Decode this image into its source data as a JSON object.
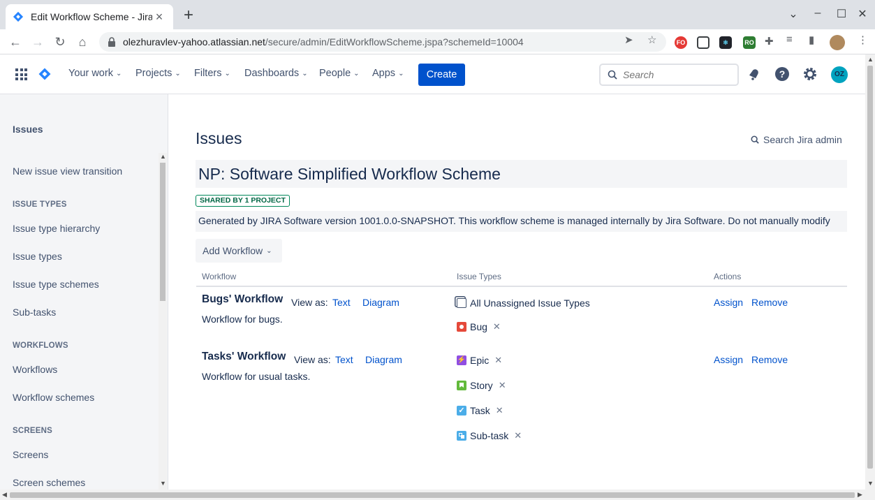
{
  "browser": {
    "tab_title": "Edit Workflow Scheme - Jira",
    "url_host": "olezhuravlev-yahoo.atlassian.net",
    "url_path": "/secure/admin/EditWorkflowScheme.jspa?schemeId=10004",
    "extensions": [
      "FO",
      "",
      "",
      "RO"
    ]
  },
  "topnav": {
    "items": [
      "Your work",
      "Projects",
      "Filters",
      "Dashboards",
      "People",
      "Apps"
    ],
    "create_label": "Create",
    "search_placeholder": "Search",
    "avatar_initials": "OZ"
  },
  "sidebar": {
    "title": "Issues",
    "items": [
      {
        "type": "item",
        "label": "New issue view transition"
      },
      {
        "type": "header",
        "label": "ISSUE TYPES"
      },
      {
        "type": "item",
        "label": "Issue type hierarchy"
      },
      {
        "type": "item",
        "label": "Issue types"
      },
      {
        "type": "item",
        "label": "Issue type schemes"
      },
      {
        "type": "item",
        "label": "Sub-tasks"
      },
      {
        "type": "header",
        "label": "WORKFLOWS"
      },
      {
        "type": "item",
        "label": "Workflows"
      },
      {
        "type": "item",
        "label": "Workflow schemes"
      },
      {
        "type": "header",
        "label": "SCREENS"
      },
      {
        "type": "item",
        "label": "Screens"
      },
      {
        "type": "item",
        "label": "Screen schemes"
      }
    ]
  },
  "main": {
    "page_title": "Issues",
    "search_admin": "Search Jira admin",
    "scheme_name": "NP: Software Simplified Workflow Scheme",
    "shared_badge": "SHARED BY 1 PROJECT",
    "description": "Generated by JIRA Software version 1001.0.0-SNAPSHOT. This workflow scheme is managed internally by Jira Software. Do not manually modify",
    "add_workflow_label": "Add Workflow",
    "columns": [
      "Workflow",
      "Issue Types",
      "Actions"
    ],
    "view_as_label": "View as:",
    "view_text_label": "Text",
    "view_diagram_label": "Diagram",
    "assign_label": "Assign",
    "remove_label": "Remove",
    "workflows": [
      {
        "name": "Bugs' Workflow",
        "description": "Workflow for bugs.",
        "issue_types": [
          {
            "label": "All Unassigned Issue Types",
            "icon": "unassigned-icon",
            "removable": false
          },
          {
            "label": "Bug",
            "icon": "bug-icon",
            "removable": true
          }
        ]
      },
      {
        "name": "Tasks' Workflow",
        "description": "Workflow for usual tasks.",
        "issue_types": [
          {
            "label": "Epic",
            "icon": "epic-icon",
            "removable": true
          },
          {
            "label": "Story",
            "icon": "story-icon",
            "removable": true
          },
          {
            "label": "Task",
            "icon": "task-icon",
            "removable": true
          },
          {
            "label": "Sub-task",
            "icon": "subtask-icon",
            "removable": true
          }
        ]
      }
    ]
  },
  "colors": {
    "brand": "#0052cc",
    "link": "#0052cc",
    "text": "#172b4d",
    "bug": "#e5493a",
    "epic": "#904ee2",
    "story": "#63ba3c",
    "task": "#4bade8",
    "badge": "#00875a"
  }
}
